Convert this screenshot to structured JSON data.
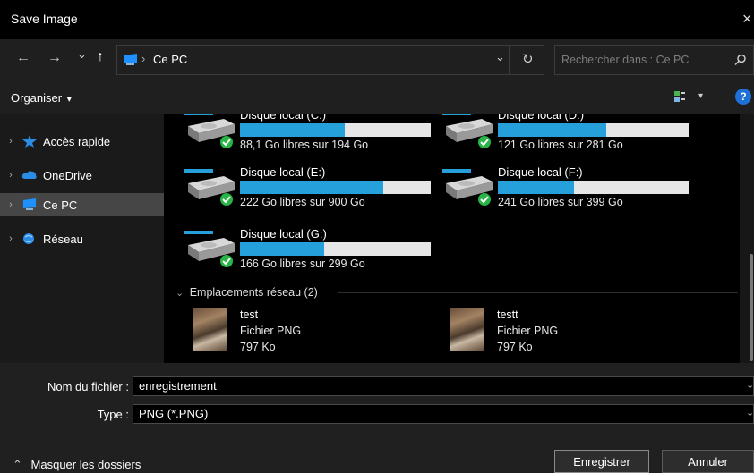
{
  "window": {
    "title": "Save Image",
    "close_glyph": "×"
  },
  "nav": {
    "back_glyph": "←",
    "forward_glyph": "→",
    "recent_glyph": "⌄",
    "up_glyph": "↑",
    "breadcrumb_sep": "›",
    "location": "Ce PC",
    "dropdown_glyph": "⌄",
    "refresh_glyph": "↻",
    "search_placeholder": "Rechercher dans : Ce PC",
    "search_glyph": "⌕"
  },
  "toolbar": {
    "organise_label": "Organiser",
    "organise_caret": "▾",
    "view_caret": "▾",
    "help_glyph": "?"
  },
  "sidebar": {
    "items": [
      {
        "label": "Accès rapide",
        "chevron": "›",
        "icon": "star-icon"
      },
      {
        "label": "OneDrive",
        "chevron": "›",
        "icon": "cloud-icon"
      },
      {
        "label": "Ce PC",
        "chevron": "›",
        "icon": "computer-icon",
        "selected": true
      },
      {
        "label": "Réseau",
        "chevron": "›",
        "icon": "network-icon"
      }
    ]
  },
  "drives": [
    {
      "name": "Disque local (C:)",
      "free": "88,1 Go libres sur 194 Go",
      "used_fraction": 0.55
    },
    {
      "name": "Disque local (D:)",
      "free": "121 Go libres sur 281 Go",
      "used_fraction": 0.57
    },
    {
      "name": "Disque local (E:)",
      "free": "222 Go libres sur 900 Go",
      "used_fraction": 0.75
    },
    {
      "name": "Disque local (F:)",
      "free": "241 Go libres sur 399 Go",
      "used_fraction": 0.4
    },
    {
      "name": "Disque local (G:)",
      "free": "166 Go libres sur 299 Go",
      "used_fraction": 0.44
    }
  ],
  "network_section": {
    "label": "Emplacements réseau (2)",
    "chevron": "⌄"
  },
  "files": [
    {
      "name": "test",
      "type": "Fichier PNG",
      "size": "797 Ko"
    },
    {
      "name": "testt",
      "type": "Fichier PNG",
      "size": "797 Ko"
    }
  ],
  "form": {
    "filename_label": "Nom du fichier :",
    "filename_value": "enregistrement",
    "type_label": "Type :",
    "type_value": "PNG (*.PNG)",
    "dropdown_glyph": "⌄"
  },
  "footer": {
    "hide_folders_glyph": "⌃",
    "hide_folders_label": "Masquer les dossiers",
    "save_label": "Enregistrer",
    "cancel_label": "Annuler"
  },
  "colors": {
    "accent": "#26a0da",
    "check": "#28b446"
  }
}
